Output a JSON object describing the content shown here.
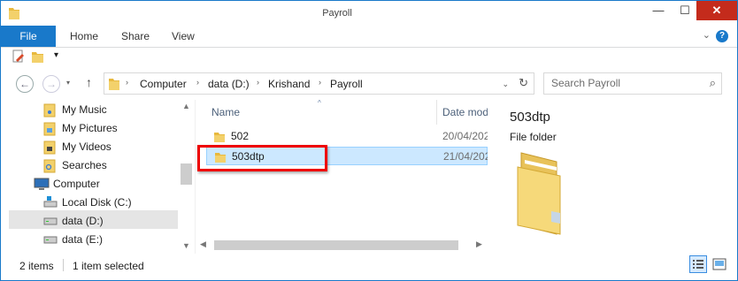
{
  "window": {
    "title": "Payroll",
    "minimize_glyph": "—",
    "maximize_glyph": "☐",
    "close_glyph": "✕"
  },
  "ribbon": {
    "tabs": [
      "File",
      "Home",
      "Share",
      "View"
    ],
    "help_glyph": "?",
    "expand_glyph": "⌄"
  },
  "qat": {
    "customize_glyph": "▾"
  },
  "nav": {
    "back_glyph": "←",
    "forward_glyph": "→",
    "recent_glyph": "▾",
    "up_glyph": "↑"
  },
  "address": {
    "crumbs": [
      "Computer",
      "data (D:)",
      "Krishand",
      "Payroll"
    ],
    "separator": "›",
    "dropdown_glyph": "⌄",
    "refresh_glyph": "↻"
  },
  "search": {
    "placeholder": "Search Payroll",
    "icon_glyph": "⌕"
  },
  "navpane": {
    "items": [
      {
        "label": "My Music",
        "icon": "music-folder-icon"
      },
      {
        "label": "My Pictures",
        "icon": "pictures-folder-icon"
      },
      {
        "label": "My Videos",
        "icon": "videos-folder-icon"
      },
      {
        "label": "Searches",
        "icon": "searches-folder-icon"
      },
      {
        "label": "Computer",
        "icon": "computer-icon"
      },
      {
        "label": "Local Disk (C:)",
        "icon": "drive-icon"
      },
      {
        "label": "data (D:)",
        "icon": "drive-icon",
        "selected": true
      },
      {
        "label": "data (E:)",
        "icon": "drive-icon"
      }
    ]
  },
  "filelist": {
    "columns": {
      "name": "Name",
      "date": "Date mod"
    },
    "sort_glyph": "^",
    "rows": [
      {
        "name": "502",
        "date": "20/04/202"
      },
      {
        "name": "503dtp",
        "date": "21/04/202",
        "selected": true
      }
    ]
  },
  "preview": {
    "title": "503dtp",
    "type": "File folder"
  },
  "status": {
    "item_count": "2 items",
    "selection": "1 item selected"
  },
  "scroll_glyphs": {
    "up": "▲",
    "down": "▼",
    "left": "◀",
    "right": "▶"
  },
  "colors": {
    "accent": "#1979ca",
    "selection": "#cce8ff",
    "highlight_box": "#ee0000",
    "folder": "#f3d16b"
  }
}
